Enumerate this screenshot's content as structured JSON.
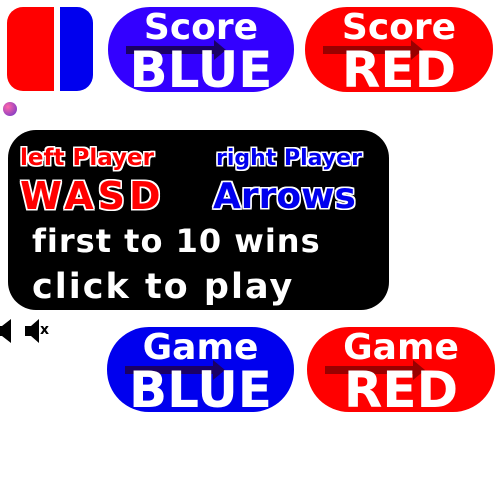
{
  "colors": {
    "blue": "#3300ff",
    "blue_alt": "#0000ee",
    "red": "#ff0000",
    "panel_bg": "#000000",
    "text_white": "#ffffff",
    "arrow_blue": "#1a0066",
    "arrow_red": "#990000",
    "dot": "#cc3366"
  },
  "logo": {
    "icon": "red-blue-split-logo"
  },
  "score": {
    "blue": {
      "top": "Score",
      "bottom": "BLUE"
    },
    "red": {
      "top": "Score",
      "bottom": "RED"
    }
  },
  "instructions": {
    "left_player_label": "left Player",
    "right_player_label": "right Player",
    "left_keys": "WASD",
    "right_keys": "Arrows",
    "rule": "first to 10 wins",
    "cta": "click to play"
  },
  "sound": {
    "on_icon": "speaker-icon",
    "off_icon": "speaker-muted-icon",
    "mute_mark": "x"
  },
  "game": {
    "blue": {
      "top": "Game",
      "bottom": "BLUE"
    },
    "red": {
      "top": "Game",
      "bottom": "RED"
    }
  }
}
